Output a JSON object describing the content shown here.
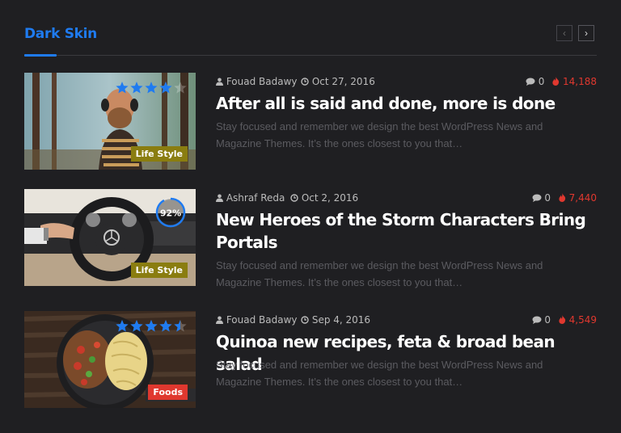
{
  "section": {
    "title": "Dark Skin",
    "accent_color": "#1f7bf0",
    "nav": {
      "prev_icon": "chevron-left-icon",
      "next_icon": "chevron-right-icon",
      "prev": "‹",
      "next": "›"
    }
  },
  "posts": [
    {
      "author": "Fouad Badawy",
      "date": "Oct 27, 2016",
      "comments": "0",
      "views": "14,188",
      "title": "After all is said and done, more is done",
      "excerpt": "Stay focused and remember we design the best WordPress News and Magazine Themes. It’s the ones closest to you that…",
      "category": "Life Style",
      "category_color": "#8a7d10",
      "rating_type": "stars",
      "stars": 4
    },
    {
      "author": "Ashraf Reda",
      "date": "Oct 2, 2016",
      "comments": "0",
      "views": "7,440",
      "title": "New Heroes of the Storm Characters Bring Portals",
      "excerpt": "Stay focused and remember we design the best WordPress News and Magazine Themes. It’s the ones closest to you that…",
      "category": "Life Style",
      "category_color": "#8a7d10",
      "rating_type": "percent",
      "percent": "92%",
      "percent_value": 0.92
    },
    {
      "author": "Fouad Badawy",
      "date": "Sep 4, 2016",
      "comments": "0",
      "views": "4,549",
      "title": "Quinoa new recipes, feta & broad bean salad",
      "excerpt": "Stay focused and remember we design the best WordPress News and Magazine Themes. It’s the ones closest to you that…",
      "category": "Foods",
      "category_color": "#e0382f",
      "rating_type": "stars",
      "stars": 4.5
    }
  ],
  "icons": {
    "author": "user-icon",
    "date": "clock-icon",
    "comments": "comment-icon",
    "views": "fire-icon"
  }
}
